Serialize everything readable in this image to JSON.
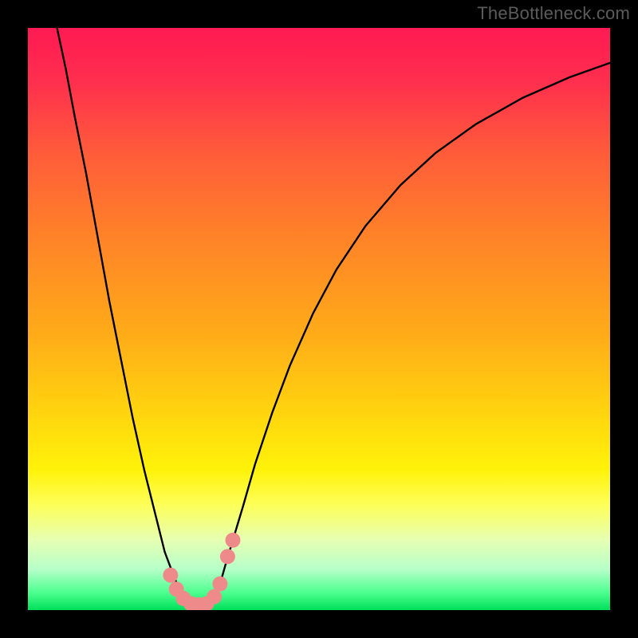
{
  "watermark": "TheBottleneck.com",
  "chart_data": {
    "type": "line",
    "title": "",
    "xlabel": "",
    "ylabel": "",
    "xlim": [
      0,
      100
    ],
    "ylim": [
      0,
      100
    ],
    "grid": false,
    "background_gradient_stops": [
      {
        "offset": 0.0,
        "color": "#ff1a53"
      },
      {
        "offset": 0.09,
        "color": "#ff2e4e"
      },
      {
        "offset": 0.21,
        "color": "#ff5a3b"
      },
      {
        "offset": 0.35,
        "color": "#ff8029"
      },
      {
        "offset": 0.52,
        "color": "#ffaa19"
      },
      {
        "offset": 0.66,
        "color": "#ffd40e"
      },
      {
        "offset": 0.76,
        "color": "#fff30a"
      },
      {
        "offset": 0.82,
        "color": "#fdff5a"
      },
      {
        "offset": 0.88,
        "color": "#e6ffb3"
      },
      {
        "offset": 0.93,
        "color": "#b6ffc9"
      },
      {
        "offset": 0.97,
        "color": "#4dff8f"
      },
      {
        "offset": 1.0,
        "color": "#00e05a"
      }
    ],
    "series": [
      {
        "name": "bottleneck-curve",
        "stroke": "#000000",
        "points": [
          {
            "x": 5.0,
            "y": 100.0
          },
          {
            "x": 6.5,
            "y": 93.0
          },
          {
            "x": 8.0,
            "y": 85.0
          },
          {
            "x": 10.0,
            "y": 75.0
          },
          {
            "x": 12.0,
            "y": 64.0
          },
          {
            "x": 14.0,
            "y": 53.0
          },
          {
            "x": 16.0,
            "y": 43.0
          },
          {
            "x": 18.0,
            "y": 33.0
          },
          {
            "x": 20.0,
            "y": 24.0
          },
          {
            "x": 22.0,
            "y": 16.0
          },
          {
            "x": 23.5,
            "y": 10.0
          },
          {
            "x": 25.0,
            "y": 6.0
          },
          {
            "x": 26.0,
            "y": 3.5
          },
          {
            "x": 27.0,
            "y": 2.0
          },
          {
            "x": 28.0,
            "y": 1.2
          },
          {
            "x": 29.0,
            "y": 0.9
          },
          {
            "x": 30.0,
            "y": 0.9
          },
          {
            "x": 31.0,
            "y": 1.2
          },
          {
            "x": 32.0,
            "y": 2.3
          },
          {
            "x": 33.0,
            "y": 4.5
          },
          {
            "x": 34.0,
            "y": 8.0
          },
          {
            "x": 35.5,
            "y": 13.0
          },
          {
            "x": 37.0,
            "y": 18.0
          },
          {
            "x": 39.0,
            "y": 25.0
          },
          {
            "x": 42.0,
            "y": 34.0
          },
          {
            "x": 45.0,
            "y": 42.0
          },
          {
            "x": 49.0,
            "y": 51.0
          },
          {
            "x": 53.0,
            "y": 58.5
          },
          {
            "x": 58.0,
            "y": 66.0
          },
          {
            "x": 64.0,
            "y": 73.0
          },
          {
            "x": 70.0,
            "y": 78.5
          },
          {
            "x": 77.0,
            "y": 83.5
          },
          {
            "x": 85.0,
            "y": 88.0
          },
          {
            "x": 93.0,
            "y": 91.5
          },
          {
            "x": 100.0,
            "y": 94.0
          }
        ]
      }
    ],
    "markers": [
      {
        "x": 24.5,
        "y": 6.0,
        "color": "#ef8a8a"
      },
      {
        "x": 25.5,
        "y": 3.6,
        "color": "#ef8a8a"
      },
      {
        "x": 26.7,
        "y": 2.0,
        "color": "#ef8a8a"
      },
      {
        "x": 28.0,
        "y": 1.1,
        "color": "#ef8a8a"
      },
      {
        "x": 29.3,
        "y": 0.9,
        "color": "#ef8a8a"
      },
      {
        "x": 30.7,
        "y": 1.1,
        "color": "#ef8a8a"
      },
      {
        "x": 32.0,
        "y": 2.3,
        "color": "#ef8a8a"
      },
      {
        "x": 33.0,
        "y": 4.5,
        "color": "#ef8a8a"
      },
      {
        "x": 34.3,
        "y": 9.2,
        "color": "#ef8a8a"
      },
      {
        "x": 35.2,
        "y": 12.0,
        "color": "#ef8a8a"
      }
    ]
  }
}
